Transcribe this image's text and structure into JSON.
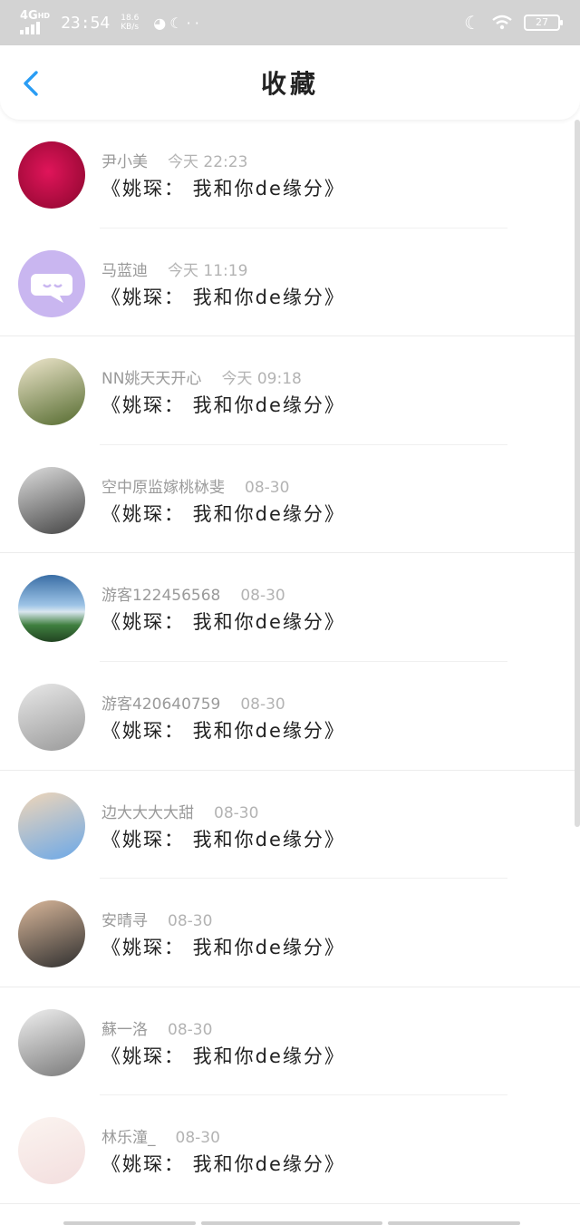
{
  "status_bar": {
    "network": "4G",
    "network_sub": "HD",
    "time": "23:54",
    "speed_value": "18.6",
    "speed_unit": "KB/s",
    "battery": "27"
  },
  "header": {
    "title": "收藏"
  },
  "items": [
    {
      "name": "尹小美",
      "time": "今天 22:23",
      "title": "《姚琛： 我和你de缘分》",
      "avatar_colors": [
        "#e0155a",
        "#a30a3a"
      ],
      "avatar_kind": "rose"
    },
    {
      "name": "马蓝迪",
      "time": "今天 11:19",
      "title": "《姚琛： 我和你de缘分》",
      "avatar_colors": [
        "#c9b6f0",
        "#ffffff"
      ],
      "avatar_kind": "chat"
    },
    {
      "name": "NN姚天天开心",
      "time": "今天 09:18",
      "title": "《姚琛： 我和你de缘分》",
      "avatar_colors": [
        "#556b2f",
        "#eee6cc"
      ],
      "avatar_kind": "photo"
    },
    {
      "name": "空中原监嫁桃栤斐",
      "time": "08-30",
      "title": "《姚琛： 我和你de缘分》",
      "avatar_colors": [
        "#444444",
        "#dddddd"
      ],
      "avatar_kind": "photo"
    },
    {
      "name": "游客122456568",
      "time": "08-30",
      "title": "《姚琛： 我和你de缘分》",
      "avatar_colors": [
        "#3a6ea5",
        "#3f7f3f"
      ],
      "avatar_kind": "landscape"
    },
    {
      "name": "游客420640759",
      "time": "08-30",
      "title": "《姚琛： 我和你de缘分》",
      "avatar_colors": [
        "#9a9a9a",
        "#e8e8e8"
      ],
      "avatar_kind": "photo"
    },
    {
      "name": "边大大大大甜",
      "time": "08-30",
      "title": "《姚琛： 我和你de缘分》",
      "avatar_colors": [
        "#6ba8e8",
        "#f0d6b8"
      ],
      "avatar_kind": "photo"
    },
    {
      "name": "安晴寻",
      "time": "08-30",
      "title": "《姚琛： 我和你de缘分》",
      "avatar_colors": [
        "#2f2f2f",
        "#d9b79a"
      ],
      "avatar_kind": "photo"
    },
    {
      "name": "蘇一洛",
      "time": "08-30",
      "title": "《姚琛： 我和你de缘分》",
      "avatar_colors": [
        "#7a7a7a",
        "#efefef"
      ],
      "avatar_kind": "photo"
    },
    {
      "name": "林乐潼_",
      "time": "08-30",
      "title": "《姚琛： 我和你de缘分》",
      "avatar_colors": [
        "#f3dede",
        "#fbf4f0"
      ],
      "avatar_kind": "photo"
    }
  ]
}
